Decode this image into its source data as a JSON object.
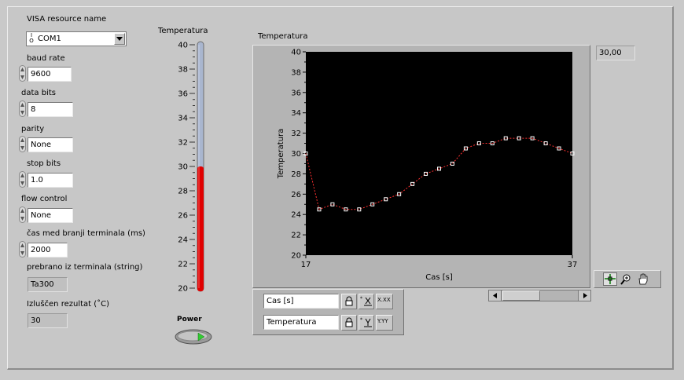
{
  "visa": {
    "label": "VISA resource name",
    "value": "COM1",
    "icon_glyph": "I/O"
  },
  "baud_rate": {
    "label": "baud rate",
    "value": "9600"
  },
  "data_bits": {
    "label": "data bits",
    "value": "8"
  },
  "parity": {
    "label": "parity",
    "value": "None"
  },
  "stop_bits": {
    "label": "stop bits",
    "value": "1.0"
  },
  "flow_control": {
    "label": "flow control",
    "value": "None"
  },
  "interval": {
    "label": "čas med branji terminala (ms)",
    "value": "2000"
  },
  "raw_read": {
    "label": "prebrano iz terminala (string)",
    "value": "Ta300"
  },
  "result": {
    "label": "Izluščen rezultat (˚C)",
    "value": "30"
  },
  "thermometer": {
    "label": "Temperatura",
    "min": 20,
    "max": 40,
    "value": 30,
    "ticks": [
      "40",
      "38",
      "36",
      "34",
      "32",
      "30",
      "28",
      "26",
      "24",
      "22",
      "20"
    ],
    "fill_color": "#e00000",
    "empty_color": "#a9b6cf"
  },
  "power": {
    "label": "Power",
    "led_color": "#33cc33"
  },
  "chart": {
    "title": "Temperatura",
    "digital_display": "30,00",
    "x_axis_name": "Cas [s]",
    "y_axis_name": "Temperatura",
    "plot_background": "#000000",
    "trace_color": "#ff3030",
    "marker_color": "#ffffff"
  },
  "scale_legend": {
    "x_name": "Cas [s]",
    "y_name": "Temperatura",
    "x_format_label": "X.XX",
    "y_format_label": "Y.YY"
  },
  "palette_tools": [
    "cursor-tool-icon",
    "zoom-tool-icon",
    "pan-tool-icon"
  ],
  "chart_data": {
    "type": "line",
    "title": "Temperatura",
    "xlabel": "Cas [s]",
    "ylabel": "Temperatura",
    "xlim": [
      17,
      37
    ],
    "ylim": [
      20,
      40
    ],
    "x_tick_labels": [
      "17",
      "37"
    ],
    "y_ticks": [
      "20",
      "22",
      "24",
      "26",
      "28",
      "30",
      "32",
      "34",
      "36",
      "38",
      "40"
    ],
    "grid": false,
    "series": [
      {
        "x": [
          17,
          18,
          19,
          20,
          21,
          22,
          23,
          24,
          25,
          26,
          27,
          28,
          29,
          30,
          31,
          32,
          33,
          34,
          35,
          36,
          37
        ],
        "y": [
          30,
          24.5,
          25,
          24.5,
          24.5,
          25,
          25.5,
          26,
          27,
          28,
          28.5,
          29,
          30.5,
          31,
          31,
          31.5,
          31.5,
          31.5,
          31,
          30.5,
          30
        ]
      }
    ]
  }
}
